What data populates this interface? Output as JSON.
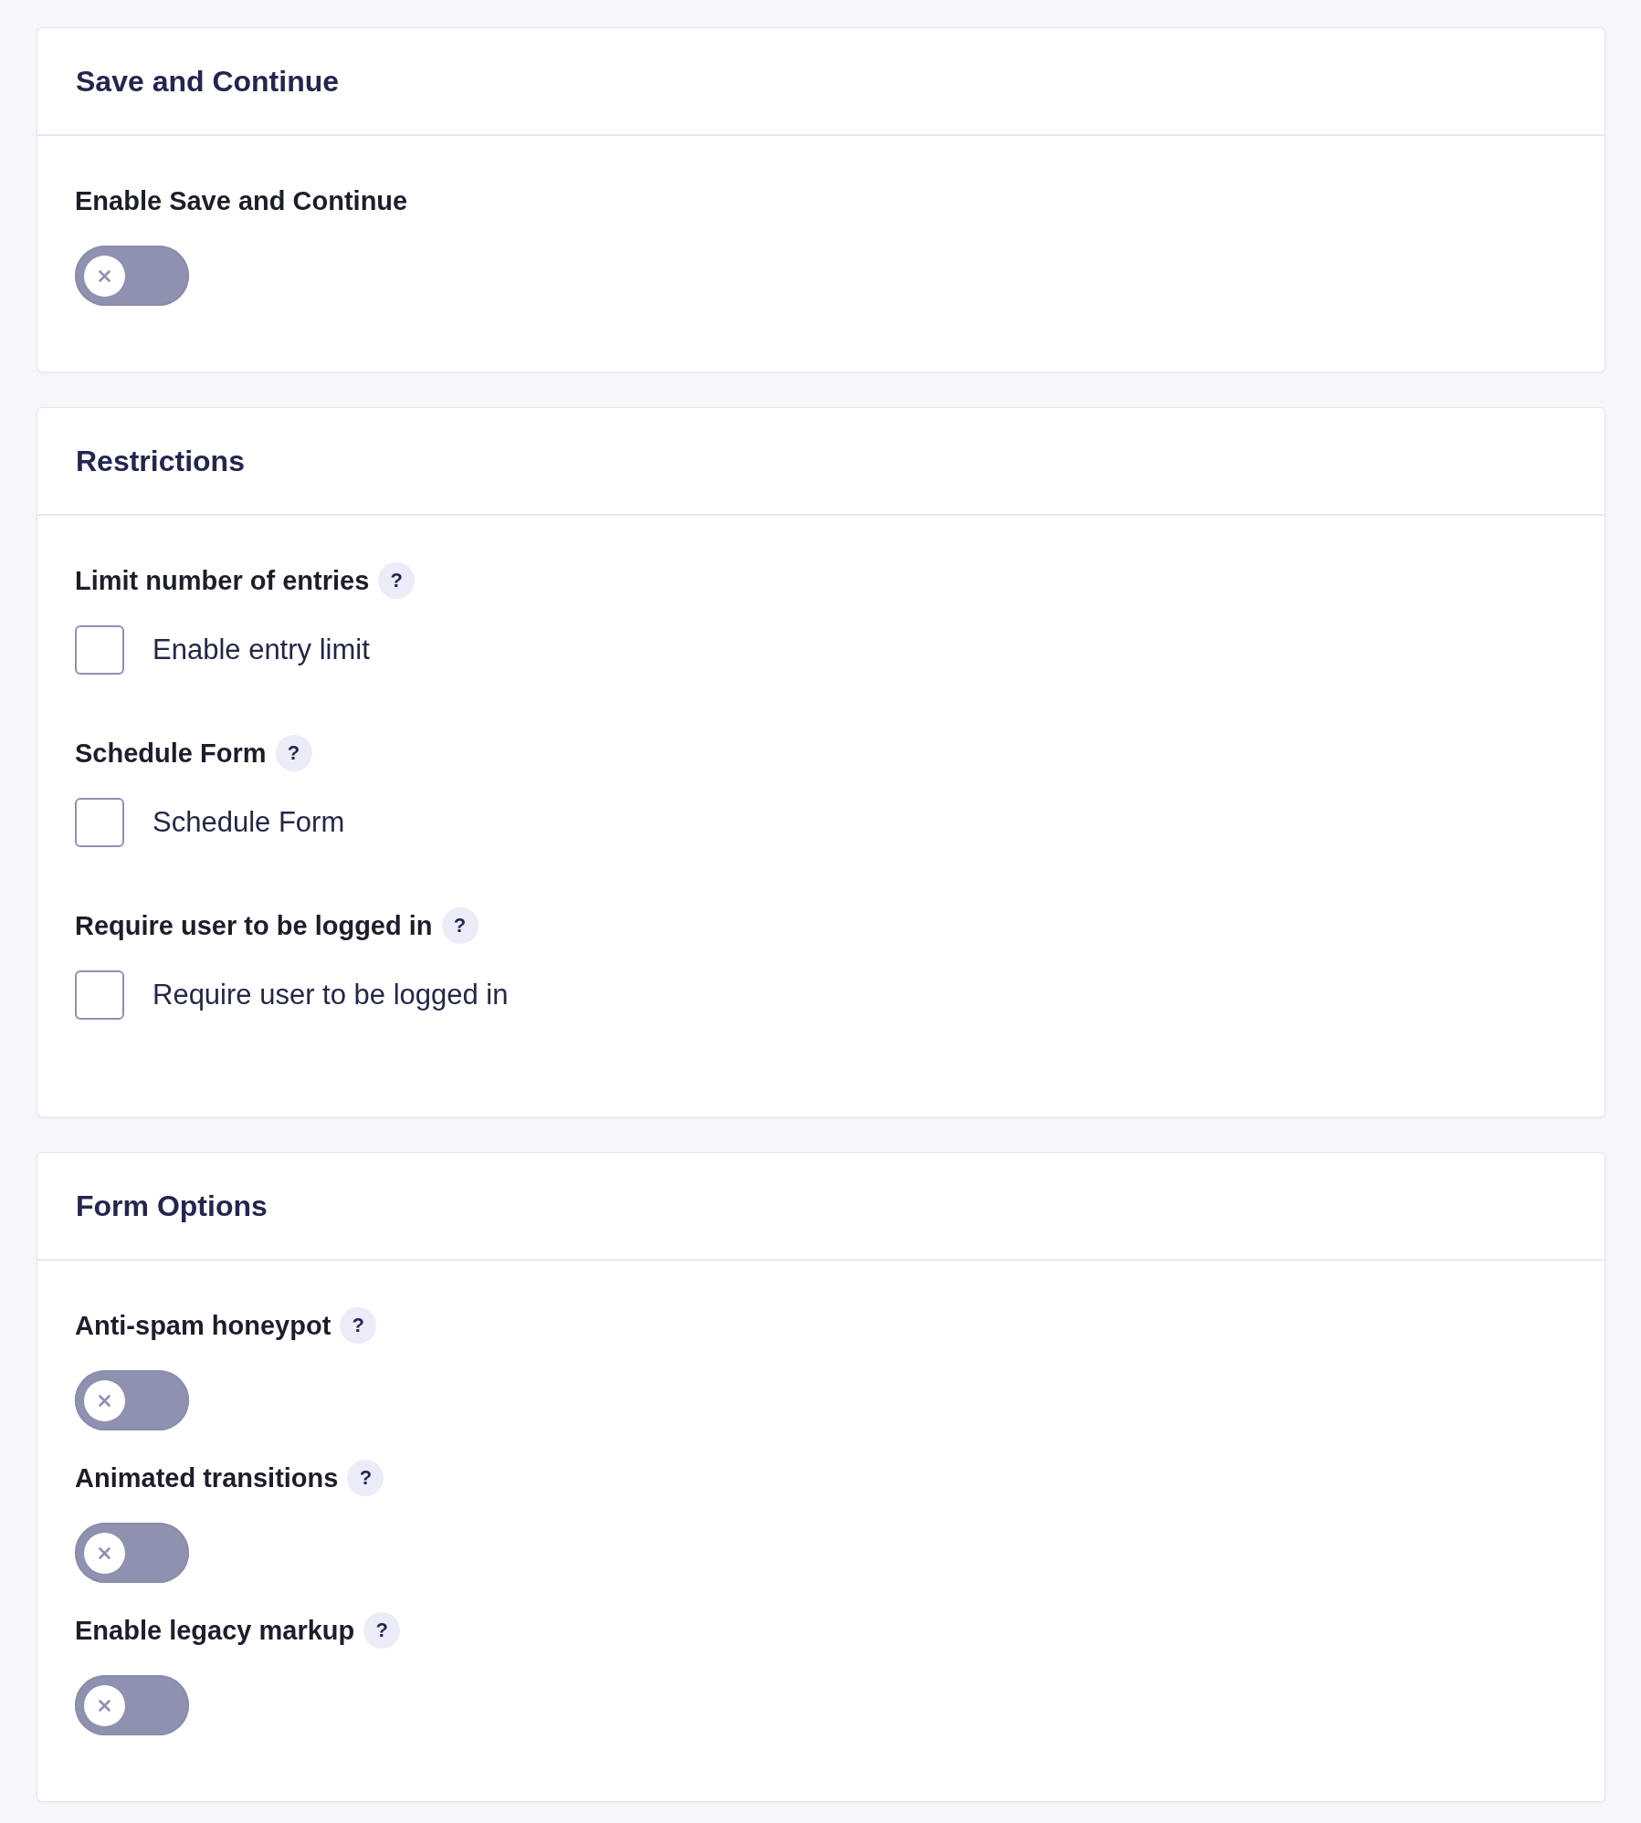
{
  "sections": [
    {
      "title": "Save and Continue",
      "fields": [
        {
          "kind": "toggle",
          "label": "Enable Save and Continue",
          "on": false
        }
      ]
    },
    {
      "title": "Restrictions",
      "fields": [
        {
          "kind": "checkbox",
          "label": "Limit number of entries",
          "help": "?",
          "option": "Enable entry limit",
          "checked": false
        },
        {
          "kind": "checkbox",
          "label": "Schedule Form",
          "help": "?",
          "option": "Schedule Form",
          "checked": false
        },
        {
          "kind": "checkbox",
          "label": "Require user to be logged in",
          "help": "?",
          "option": "Require user to be logged in",
          "checked": false
        }
      ]
    },
    {
      "title": "Form Options",
      "fields": [
        {
          "kind": "toggle",
          "label": "Anti-spam honeypot",
          "help": "?",
          "on": false
        },
        {
          "kind": "toggle",
          "label": "Animated transitions",
          "help": "?",
          "on": false
        },
        {
          "kind": "toggle",
          "label": "Enable legacy markup",
          "help": "?",
          "on": false
        }
      ]
    }
  ]
}
